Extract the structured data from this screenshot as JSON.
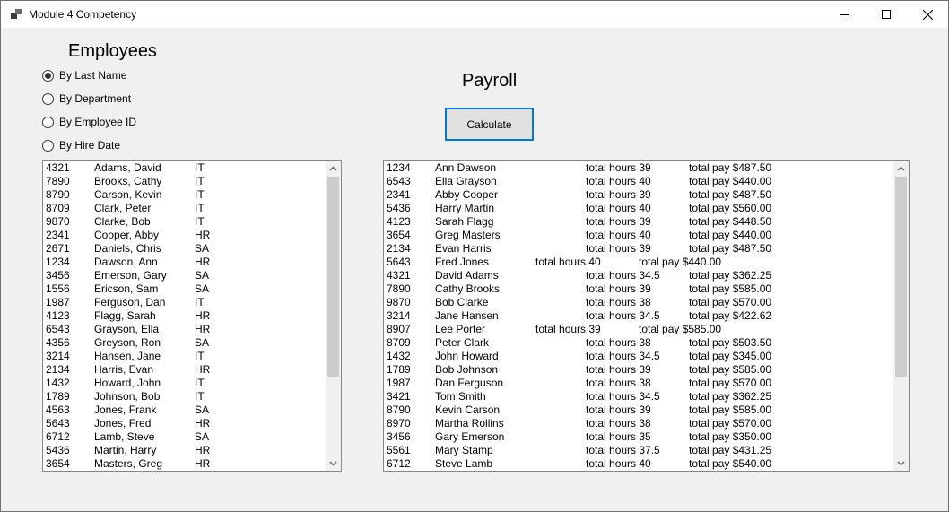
{
  "window": {
    "title": "Module 4 Competency"
  },
  "headings": {
    "employees": "Employees",
    "payroll": "Payroll"
  },
  "sort_options": [
    {
      "label": "By Last Name",
      "checked": true
    },
    {
      "label": "By Department",
      "checked": false
    },
    {
      "label": "By Employee ID",
      "checked": false
    },
    {
      "label": "By Hire Date",
      "checked": false
    }
  ],
  "calculate_label": "Calculate",
  "employees": [
    {
      "id": "4321",
      "name": "Adams, David",
      "dept": "IT"
    },
    {
      "id": "7890",
      "name": "Brooks, Cathy",
      "dept": "IT"
    },
    {
      "id": "8790",
      "name": "Carson, Kevin",
      "dept": "IT"
    },
    {
      "id": "8709",
      "name": "Clark, Peter",
      "dept": "IT"
    },
    {
      "id": "9870",
      "name": "Clarke, Bob",
      "dept": "IT"
    },
    {
      "id": "2341",
      "name": "Cooper, Abby",
      "dept": "HR"
    },
    {
      "id": "2671",
      "name": "Daniels, Chris",
      "dept": "SA"
    },
    {
      "id": "1234",
      "name": "Dawson, Ann",
      "dept": "HR"
    },
    {
      "id": "3456",
      "name": "Emerson, Gary",
      "dept": "SA"
    },
    {
      "id": "1556",
      "name": "Ericson, Sam",
      "dept": "SA"
    },
    {
      "id": "1987",
      "name": "Ferguson, Dan",
      "dept": "IT"
    },
    {
      "id": "4123",
      "name": "Flagg, Sarah",
      "dept": "HR"
    },
    {
      "id": "6543",
      "name": "Grayson, Ella",
      "dept": "HR"
    },
    {
      "id": "4356",
      "name": "Greyson, Ron",
      "dept": "SA"
    },
    {
      "id": "3214",
      "name": "Hansen, Jane",
      "dept": "IT"
    },
    {
      "id": "2134",
      "name": "Harris, Evan",
      "dept": "HR"
    },
    {
      "id": "1432",
      "name": "Howard, John",
      "dept": "IT"
    },
    {
      "id": "1789",
      "name": "Johnson, Bob",
      "dept": "IT"
    },
    {
      "id": "4563",
      "name": "Jones, Frank",
      "dept": "SA"
    },
    {
      "id": "5643",
      "name": "Jones, Fred",
      "dept": "HR"
    },
    {
      "id": "6712",
      "name": "Lamb, Steve",
      "dept": "SA"
    },
    {
      "id": "5436",
      "name": "Martin, Harry",
      "dept": "HR"
    },
    {
      "id": "3654",
      "name": "Masters, Greg",
      "dept": "HR"
    }
  ],
  "payroll": [
    {
      "id": "1234",
      "name": "Ann Dawson",
      "hours": "total hours 39",
      "pay": "total pay $487.50"
    },
    {
      "id": "6543",
      "name": "Ella Grayson",
      "hours": "total hours 40",
      "pay": "total pay $440.00"
    },
    {
      "id": "2341",
      "name": "Abby Cooper",
      "hours": "total hours 39",
      "pay": "total pay $487.50"
    },
    {
      "id": "5436",
      "name": "Harry Martin",
      "hours": "total hours 40",
      "pay": "total pay $560.00"
    },
    {
      "id": "4123",
      "name": "Sarah Flagg",
      "hours": "total hours 39",
      "pay": "total pay $448.50"
    },
    {
      "id": "3654",
      "name": "Greg Masters",
      "hours": "total hours 40",
      "pay": "total pay $440.00"
    },
    {
      "id": "2134",
      "name": "Evan Harris",
      "hours": "total hours 39",
      "pay": "total pay $487.50"
    },
    {
      "id": "5643",
      "name": "Fred Jones",
      "hours": "total hours 40",
      "pay": "total pay $440.00",
      "tight": true
    },
    {
      "id": "4321",
      "name": "David Adams",
      "hours": "total hours 34.5",
      "pay": "total pay $362.25"
    },
    {
      "id": "7890",
      "name": "Cathy Brooks",
      "hours": "total hours 39",
      "pay": "total pay $585.00"
    },
    {
      "id": "9870",
      "name": "Bob Clarke",
      "hours": "total hours 38",
      "pay": "total pay $570.00"
    },
    {
      "id": "3214",
      "name": "Jane Hansen",
      "hours": "total hours 34.5",
      "pay": "total pay $422.62"
    },
    {
      "id": "8907",
      "name": "Lee Porter",
      "hours": "total hours 39",
      "pay": "total pay $585.00",
      "tight": true
    },
    {
      "id": "8709",
      "name": "Peter Clark",
      "hours": "total hours 38",
      "pay": "total pay $503.50"
    },
    {
      "id": "1432",
      "name": "John Howard",
      "hours": "total hours 34.5",
      "pay": "total pay $345.00"
    },
    {
      "id": "1789",
      "name": "Bob Johnson",
      "hours": "total hours 39",
      "pay": "total pay $585.00"
    },
    {
      "id": "1987",
      "name": "Dan Ferguson",
      "hours": "total hours 38",
      "pay": "total pay $570.00"
    },
    {
      "id": "3421",
      "name": "Tom Smith",
      "hours": "total hours 34.5",
      "pay": "total pay $362.25"
    },
    {
      "id": "8790",
      "name": "Kevin Carson",
      "hours": "total hours 39",
      "pay": "total pay $585.00"
    },
    {
      "id": "8970",
      "name": "Martha Rollins",
      "hours": "total hours 38",
      "pay": "total pay $570.00"
    },
    {
      "id": "3456",
      "name": "Gary Emerson",
      "hours": "total hours 35",
      "pay": "total pay $350.00"
    },
    {
      "id": "5561",
      "name": "Mary Stamp",
      "hours": "total hours 37.5",
      "pay": "total pay $431.25"
    },
    {
      "id": "6712",
      "name": "Steve Lamb",
      "hours": "total hours 40",
      "pay": "total pay $540.00"
    }
  ]
}
